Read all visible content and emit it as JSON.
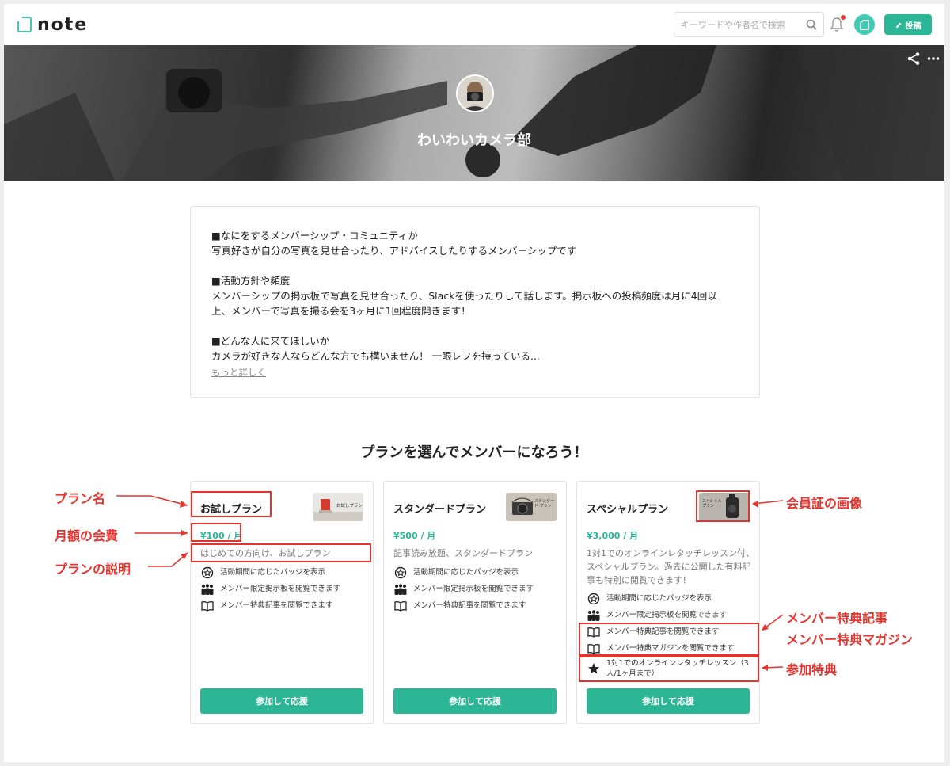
{
  "header": {
    "logo_text": "note",
    "search_placeholder": "キーワードや作者名で検索",
    "post_label": "投稿"
  },
  "hero": {
    "title": "わいわいカメラ部"
  },
  "description": {
    "lines": [
      "■なにをするメンバーシップ・コミュニティか",
      "写真好きが自分の写真を見せ合ったり、アドバイスしたりするメンバーシップです",
      "■活動方針や頻度",
      "メンバーシップの掲示板で写真を見せ合ったり、Slackを使ったりして話します。掲示板への投稿頻度は月に4回以",
      "上、メンバーで写真を撮る会を3ヶ月に1回程度開きます！",
      "■どんな人に来てほしいか",
      "カメラが好きな人ならどんな方でも構いません！ 一眼レフを持っている..."
    ],
    "more_link": "もっと詳しく"
  },
  "plans_section_title": "プランを選んでメンバーになろう！",
  "plans": [
    {
      "name": "お試しプラン",
      "price": "¥100 / 月",
      "description": "はじめての方向け、お試しプラン",
      "thumb_text": "お試しプラン",
      "perks": [
        {
          "icon": "badge-icon",
          "text": "活動期間に応じたバッジを表示"
        },
        {
          "icon": "members-icon",
          "text": "メンバー限定掲示板を閲覧できます"
        },
        {
          "icon": "book-icon",
          "text": "メンバー特典記事を閲覧できます"
        }
      ],
      "button": "参加して応援"
    },
    {
      "name": "スタンダードプラン",
      "price": "¥500 / 月",
      "description": "記事読み放題、スタンダードプラン",
      "thumb_text": "スタンダード プラン",
      "perks": [
        {
          "icon": "badge-icon",
          "text": "活動期間に応じたバッジを表示"
        },
        {
          "icon": "members-icon",
          "text": "メンバー限定掲示板を閲覧できます"
        },
        {
          "icon": "book-icon",
          "text": "メンバー特典記事を閲覧できます"
        }
      ],
      "button": "参加して応援"
    },
    {
      "name": "スペシャルプラン",
      "price": "¥3,000 / 月",
      "description": "1対1でのオンラインレタッチレッスン付、スペシャルプラン。過去に公開した有料記事も特別に閲覧できます！",
      "thumb_text": "スペシャル プラン",
      "perks": [
        {
          "icon": "badge-icon",
          "text": "活動期間に応じたバッジを表示"
        },
        {
          "icon": "members-icon",
          "text": "メンバー限定掲示板を閲覧できます"
        },
        {
          "icon": "book-icon",
          "text": "メンバー特典記事を閲覧できます"
        },
        {
          "icon": "book-icon",
          "text": "メンバー特典マガジンを閲覧できます"
        },
        {
          "icon": "star-icon",
          "text": "1対1でのオンラインレタッチレッスン（3人/1ヶ月まで）"
        }
      ],
      "button": "参加して応援"
    }
  ],
  "annotations": {
    "plan_name": "プラン名",
    "monthly_fee": "月額の会費",
    "plan_description": "プランの説明",
    "member_card_image": "会員証の画像",
    "member_articles": "メンバー特典記事",
    "member_magazine": "メンバー特典マガジン",
    "participation_benefit": "参加特典",
    "color": "#e5342d"
  },
  "colors": {
    "accent": "#2cb696",
    "annotation": "#e5342d"
  }
}
